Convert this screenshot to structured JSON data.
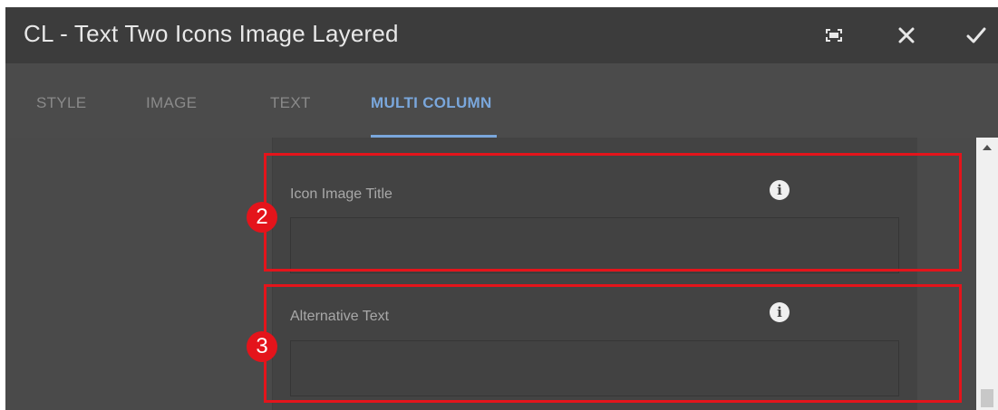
{
  "dialog": {
    "title": "CL - Text Two Icons Image Layered"
  },
  "toolbar": {
    "fullscreen_icon": "fullscreen-icon",
    "close_icon": "close-icon",
    "confirm_icon": "checkmark-icon"
  },
  "tabs": [
    {
      "label": "STYLE",
      "active": false
    },
    {
      "label": "IMAGE",
      "active": false
    },
    {
      "label": "TEXT",
      "active": false
    },
    {
      "label": "MULTI COLUMN",
      "active": true
    }
  ],
  "fields": [
    {
      "label": "Icon Image Title",
      "value": "",
      "marker": "2",
      "info_icon": "info-icon"
    },
    {
      "label": "Alternative Text",
      "value": "",
      "marker": "3",
      "info_icon": "info-icon"
    }
  ],
  "colors": {
    "accent": "#7aa7dc",
    "highlight": "#e4141b",
    "titlebar": "#3c3c3c",
    "panel": "#4a4a4a"
  }
}
